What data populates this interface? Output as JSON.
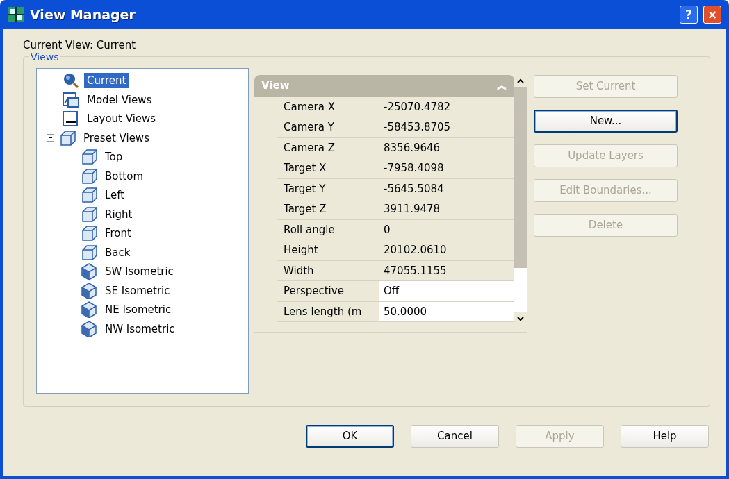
{
  "window": {
    "title": "View Manager",
    "help_label": "?",
    "close_label": "×"
  },
  "current_view": "Current View: Current",
  "views_group": {
    "title": "Views"
  },
  "tree": [
    {
      "label": "Current",
      "kind": "globe",
      "selected": true
    },
    {
      "label": "Model Views",
      "kind": "model",
      "selected": false
    },
    {
      "label": "Layout Views",
      "kind": "layout",
      "selected": false
    },
    {
      "label": "Preset Views",
      "kind": "cube",
      "selected": false,
      "expanded": true,
      "children": [
        {
          "label": "Top",
          "kind": "cube",
          "selected": false
        },
        {
          "label": "Bottom",
          "kind": "cube",
          "selected": false
        },
        {
          "label": "Left",
          "kind": "cube",
          "selected": false
        },
        {
          "label": "Right",
          "kind": "cube",
          "selected": false
        },
        {
          "label": "Front",
          "kind": "cube",
          "selected": false
        },
        {
          "label": "Back",
          "kind": "cube",
          "selected": false
        },
        {
          "label": "SW Isometric",
          "kind": "iso",
          "selected": false
        },
        {
          "label": "SE Isometric",
          "kind": "iso",
          "selected": false
        },
        {
          "label": "NE Isometric",
          "kind": "iso",
          "selected": false
        },
        {
          "label": "NW Isometric",
          "kind": "iso",
          "selected": false
        }
      ]
    }
  ],
  "properties": {
    "section": "View",
    "collapse_label": "︽",
    "rows": [
      {
        "name": "Camera X",
        "value": "-25070.4782",
        "editable": false
      },
      {
        "name": "Camera Y",
        "value": "-58453.8705",
        "editable": false
      },
      {
        "name": "Camera Z",
        "value": "8356.9646",
        "editable": false
      },
      {
        "name": "Target X",
        "value": "-7958.4098",
        "editable": false
      },
      {
        "name": "Target Y",
        "value": "-5645.5084",
        "editable": false
      },
      {
        "name": "Target Z",
        "value": "3911.9478",
        "editable": false
      },
      {
        "name": "Roll angle",
        "value": "0",
        "editable": false
      },
      {
        "name": "Height",
        "value": "20102.0610",
        "editable": false
      },
      {
        "name": "Width",
        "value": "47055.1155",
        "editable": false
      },
      {
        "name": "Perspective",
        "value": "Off",
        "editable": true
      },
      {
        "name": "Lens length (m",
        "value": "50.0000",
        "editable": true
      }
    ]
  },
  "side_buttons": [
    {
      "label": "Set Current",
      "disabled": true,
      "default": false
    },
    {
      "label": "New...",
      "disabled": false,
      "default": true
    },
    {
      "label": "Update Layers",
      "disabled": true,
      "default": false
    },
    {
      "label": "Edit Boundaries...",
      "disabled": true,
      "default": false
    },
    {
      "label": "Delete",
      "disabled": true,
      "default": false
    }
  ],
  "footer_buttons": [
    {
      "label": "OK",
      "disabled": false,
      "default": true
    },
    {
      "label": "Cancel",
      "disabled": false,
      "default": false
    },
    {
      "label": "Apply",
      "disabled": true,
      "default": false
    },
    {
      "label": "Help",
      "disabled": false,
      "default": false
    }
  ]
}
